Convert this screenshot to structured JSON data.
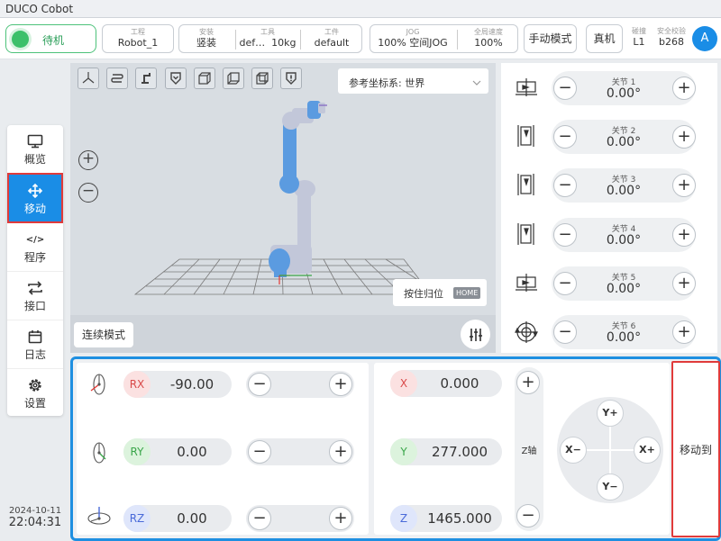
{
  "app": {
    "title": "DUCO Cobot"
  },
  "header": {
    "status": "待机",
    "project": {
      "label": "工程",
      "value": "Robot_1"
    },
    "install": {
      "label": "安装",
      "value": "竖装"
    },
    "tool": {
      "label": "工具",
      "value": "def…",
      "weight": "10kg"
    },
    "workpiece": {
      "label": "工件",
      "value": "default"
    },
    "jog": {
      "label": "JOG",
      "percent": "100%",
      "mode": "空间JOG"
    },
    "speed": {
      "label": "全局速度",
      "value": "100%"
    },
    "manual_mode": "手动模式",
    "real_machine": "真机",
    "collision": {
      "label": "碰撞",
      "value": "L1"
    },
    "safety": {
      "label": "安全校验",
      "value": "b268"
    },
    "avatar": "A"
  },
  "sidebar": {
    "items": [
      {
        "label": "概览",
        "icon": "monitor-icon"
      },
      {
        "label": "移动",
        "icon": "move-icon"
      },
      {
        "label": "程序",
        "icon": "code-icon"
      },
      {
        "label": "接口",
        "icon": "swap-icon"
      },
      {
        "label": "日志",
        "icon": "calendar-icon"
      },
      {
        "label": "设置",
        "icon": "gear-icon"
      }
    ],
    "active": 1,
    "date": "2024-10-11",
    "time": "22:04:31"
  },
  "viewport": {
    "coord_label": "参考坐标系: 世界",
    "home_hint": "按住归位",
    "home_badge": "HOME",
    "continuous_mode": "连续模式"
  },
  "joints": [
    {
      "label": "关节 1",
      "value": "0.00°"
    },
    {
      "label": "关节 2",
      "value": "0.00°"
    },
    {
      "label": "关节 3",
      "value": "0.00°"
    },
    {
      "label": "关节 4",
      "value": "0.00°"
    },
    {
      "label": "关节 5",
      "value": "0.00°"
    },
    {
      "label": "关节 6",
      "value": "0.00°"
    }
  ],
  "rotation": [
    {
      "axis": "RX",
      "value": "-90.00"
    },
    {
      "axis": "RY",
      "value": "0.00"
    },
    {
      "axis": "RZ",
      "value": "0.00"
    }
  ],
  "position": [
    {
      "axis": "X",
      "value": "0.000"
    },
    {
      "axis": "Y",
      "value": "277.000"
    },
    {
      "axis": "Z",
      "value": "1465.000"
    }
  ],
  "z_axis_label": "Z轴",
  "pad": {
    "up": "Y+",
    "down": "Y−",
    "left": "X−",
    "right": "X+"
  },
  "move_to": "移动到",
  "colors": {
    "accent": "#1a8de6",
    "highlight": "#e03b3b",
    "status_green": "#3cc06a",
    "robot_blue": "#5b9be0"
  }
}
